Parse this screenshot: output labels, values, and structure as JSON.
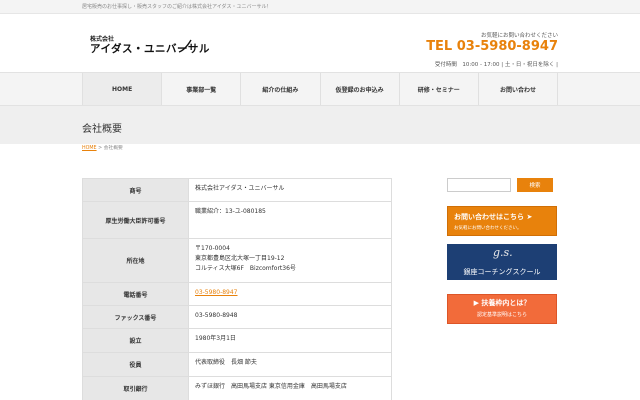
{
  "topbar": {
    "tagline": "居宅販売のお仕事探し・販売スタッフのご紹介は株式会社アイダス・ユニバーサル！"
  },
  "header": {
    "logo_small": "株式会社",
    "logo_name": "アイダス・ユニバーサル",
    "note": "お気軽にお問い合わせください",
    "tel": "TEL 03-5980-8947",
    "hours": "受付時間　10:00 - 17:00 | 土・日・祝日を除く |"
  },
  "nav": {
    "items": [
      {
        "label": "HOME"
      },
      {
        "label": "事業部一覧"
      },
      {
        "label": "紹介の仕組み"
      },
      {
        "label": "仮登録のお申込み"
      },
      {
        "label": "研修・セミナー"
      },
      {
        "label": "お問い合わせ"
      }
    ]
  },
  "page": {
    "title": "会社概要"
  },
  "breadcrumb": {
    "home": "HOME",
    "sep": " > ",
    "current": "会社概要"
  },
  "company": {
    "rows": [
      {
        "label": "商号",
        "value": "株式会社アイダス・ユニバーサル"
      },
      {
        "label": "厚生労働大臣許可番号",
        "value": "職業紹介：13-ユ-080185"
      },
      {
        "label": "所在地",
        "lines": [
          "〒170-0004",
          "東京都豊島区北大塚一丁目19-12",
          "コルティス大塚6F　Bizcomfort36号"
        ]
      },
      {
        "label": "電話番号",
        "value": "03-5980-8947"
      },
      {
        "label": "ファックス番号",
        "value": "03-5980-8948"
      },
      {
        "label": "設立",
        "value": "1980年3月1日"
      },
      {
        "label": "役員",
        "value": "代表取締役　長畑 節夫"
      },
      {
        "label": "取引銀行",
        "value": "みずほ銀行　高田馬場支店 東京信用金庫　高田馬場支店"
      }
    ]
  },
  "sidebar": {
    "search_placeholder": "",
    "search_button": "検索",
    "contact_title": "お問い合わせはこちら",
    "contact_sub": "お気軽にお問い合わせください。",
    "ginza_mark": "g.s.",
    "ginza_label": "銀座コーチングスクール",
    "fuyou_title": "扶養枠内とは？",
    "fuyou_sub": "認定基準説明はこちら"
  },
  "colors": {
    "accent": "#e8820c",
    "ginza": "#1d3f74",
    "fuyou": "#f26b3a"
  }
}
